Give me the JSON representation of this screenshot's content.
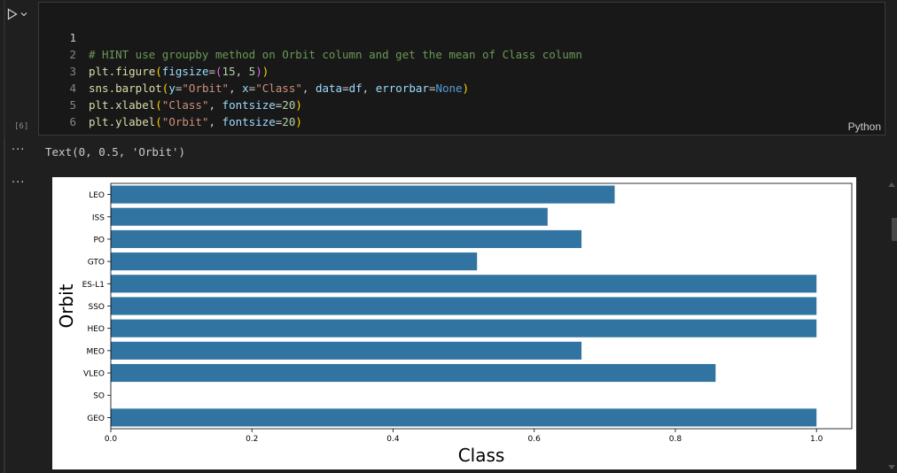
{
  "cell": {
    "execution_count": "[6]",
    "language": "Python",
    "lines": [
      {
        "n": "1",
        "active": true
      },
      {
        "n": "2"
      },
      {
        "n": "3"
      },
      {
        "n": "4"
      },
      {
        "n": "5"
      },
      {
        "n": "6"
      }
    ],
    "code": {
      "l1": "# HINT use groupby method on Orbit column and get the mean of Class column",
      "l2_fn": "plt.figure",
      "l2_arg": "figsize",
      "l2_t1": "15",
      "l2_t2": "5",
      "l3_fn": "sns.barplot",
      "l3_y": "y",
      "l3_yv": "\"Orbit\"",
      "l3_x": "x",
      "l3_xv": "\"Class\"",
      "l3_d": "data",
      "l3_dv": "df",
      "l3_e": "errorbar",
      "l3_ev": "None",
      "l4_fn": "plt.xlabel",
      "l4_s": "\"Class\"",
      "l4_k": "fontsize",
      "l4_v": "20",
      "l5_fn": "plt.ylabel",
      "l5_s": "\"Orbit\"",
      "l5_k": "fontsize",
      "l5_v": "20"
    }
  },
  "output": {
    "ellipsis": "···",
    "text": "Text(0, 0.5, 'Orbit')"
  },
  "chart_data": {
    "type": "bar",
    "orientation": "horizontal",
    "categories": [
      "LEO",
      "ISS",
      "PO",
      "GTO",
      "ES-L1",
      "SSO",
      "HEO",
      "MEO",
      "VLEO",
      "SO",
      "GEO"
    ],
    "values": [
      0.714,
      0.619,
      0.667,
      0.519,
      1.0,
      1.0,
      1.0,
      0.667,
      0.857,
      0.0,
      1.0
    ],
    "xlabel": "Class",
    "ylabel": "Orbit",
    "xlim": [
      0,
      1.05
    ],
    "xticks": [
      "0.0",
      "0.2",
      "0.4",
      "0.6",
      "0.8",
      "1.0"
    ],
    "bar_color": "#3274a1",
    "grid": false
  }
}
